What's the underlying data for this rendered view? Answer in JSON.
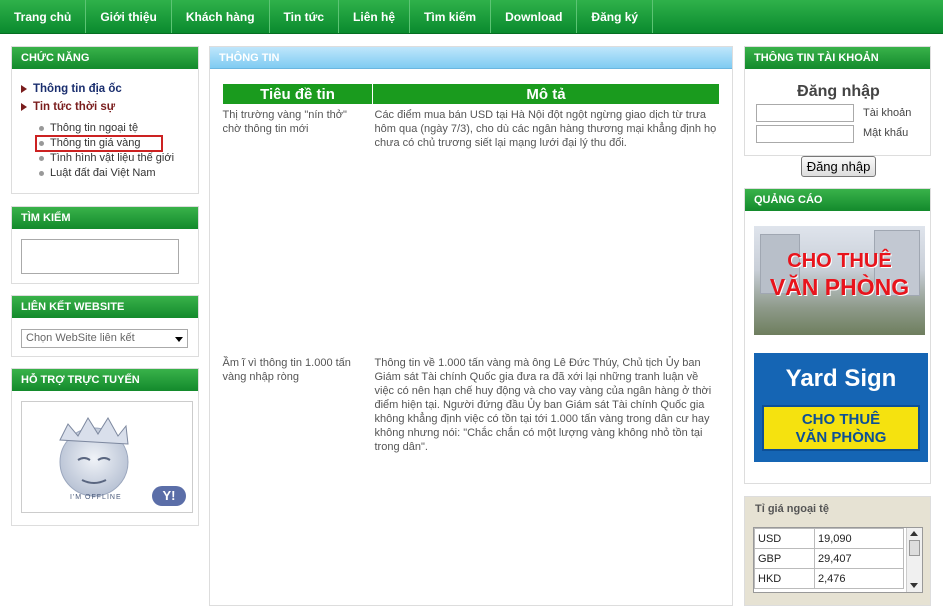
{
  "nav": [
    "Trang chủ",
    "Giới thiệu",
    "Khách hàng",
    "Tin tức",
    "Liên hệ",
    "Tìm kiếm",
    "Download",
    "Đăng ký"
  ],
  "left": {
    "chuc_nang": {
      "title": "CHỨC NĂNG",
      "main_links": [
        "Thông tin địa ốc",
        "Tin tức thời sự"
      ],
      "sub_links": [
        "Thông tin ngoại tệ",
        "Thông tin giá vàng",
        "Tình hình vật liệu thế giới",
        "Luật đất đai Việt Nam"
      ]
    },
    "tim_kiem": {
      "title": "TÌM KIẾM"
    },
    "lien_ket": {
      "title": "LIÊN KẾT WEBSITE",
      "select_value": "Chọn WebSite liên kết"
    },
    "ho_tro": {
      "title": "HỖ TRỢ TRỰC TUYẾN",
      "status_text": "I'M OFFLINE",
      "yahoo": "Y!"
    }
  },
  "main": {
    "title": "THÔNG TIN",
    "headers": [
      "Tiêu đề tin",
      "Mô tả"
    ],
    "rows": [
      {
        "title": "Thị trường vàng \"nín thở\" chờ thông tin mới",
        "desc": "Các điểm mua bán USD tại Hà Nội đột ngột ngừng giao dịch từ trưa hôm qua (ngày 7/3), cho dù các ngân hàng thương mại khẳng định họ chưa có chủ trương siết lại mạng lưới đại lý thu đổi."
      },
      {
        "title": "Ầm ĩ vì thông tin 1.000 tấn vàng nhập ròng",
        "desc": "Thông tin về 1.000 tấn vàng mà ông Lê Đức Thúy, Chủ tịch Ủy ban Giám sát Tài chính Quốc gia đưa ra đã xới lại những tranh luận về việc có nên hạn chế huy động và cho vay vàng của ngân hàng ở thời điểm hiện tại. Người đứng đầu Ủy ban Giám sát Tài chính Quốc gia không khẳng định việc có tồn tại tới 1.000 tấn vàng trong dân cư hay không nhưng nói: \"Chắc chắn có một lượng vàng không nhỏ tồn tại trong dân\"."
      }
    ]
  },
  "right": {
    "account": {
      "title": "THÔNG TIN TÀI KHOẢN",
      "heading": "Đăng nhập",
      "user_label": "Tài khoản",
      "pass_label": "Mật khẩu",
      "button": "Đăng nhập"
    },
    "ads": {
      "title": "QUẢNG CÁO",
      "ad1_line1": "CHO THUÊ",
      "ad1_line2": "VĂN PHÒNG",
      "ad2_brand": "Yard Sign",
      "ad2_line1": "CHO THUÊ",
      "ad2_line2": "VĂN PHÒNG"
    },
    "fx": {
      "title": "Tỉ giá ngoại tệ",
      "rows": [
        [
          "USD",
          "19,090"
        ],
        [
          "GBP",
          "29,407"
        ],
        [
          "HKD",
          "2,476"
        ]
      ]
    }
  },
  "colors": {
    "green": "#1a9b1e",
    "blue_header": "#7fcbf2",
    "highlight": "#cc2222"
  }
}
